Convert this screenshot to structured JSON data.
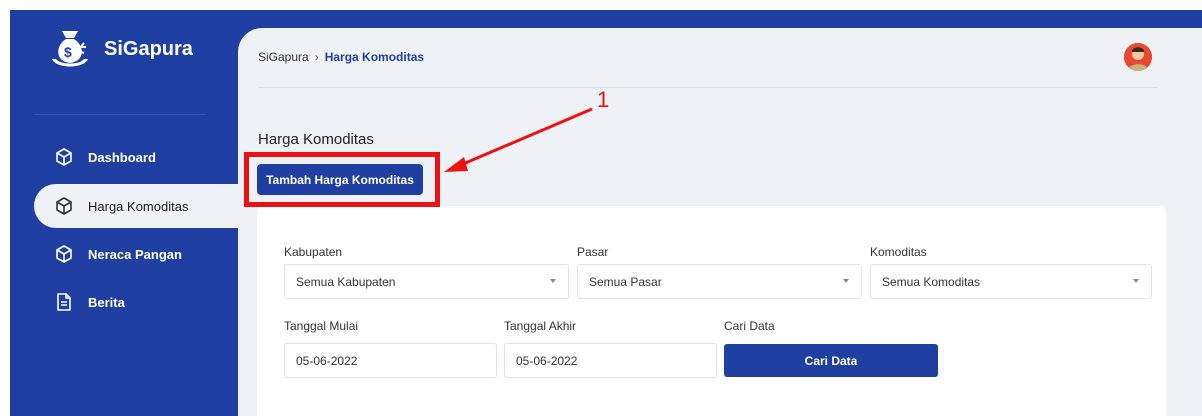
{
  "sidebar": {
    "brand": "SiGapura",
    "items": [
      {
        "label": "Dashboard",
        "icon": "cube-icon"
      },
      {
        "label": "Harga Komoditas",
        "icon": "cube-icon",
        "active": true
      },
      {
        "label": "Neraca Pangan",
        "icon": "cube-icon"
      },
      {
        "label": "Berita",
        "icon": "document-icon"
      }
    ]
  },
  "header": {
    "breadcrumb_root": "SiGapura",
    "breadcrumb_sep": "›",
    "breadcrumb_current": "Harga Komoditas"
  },
  "main": {
    "title": "Harga Komoditas",
    "add_button": "Tambah Harga Komoditas"
  },
  "filters": {
    "kabupaten_label": "Kabupaten",
    "kabupaten_value": "Semua Kabupaten",
    "pasar_label": "Pasar",
    "pasar_value": "Semua Pasar",
    "komoditas_label": "Komoditas",
    "komoditas_value": "Semua Komoditas",
    "tanggal_mulai_label": "Tanggal Mulai",
    "tanggal_mulai_value": "05-06-2022",
    "tanggal_akhir_label": "Tanggal Akhir",
    "tanggal_akhir_value": "05-06-2022",
    "cari_label": "Cari Data",
    "cari_button": "Cari Data"
  },
  "annotation": {
    "number": "1"
  },
  "colors": {
    "primary": "#1f3fa3",
    "panel": "#eef2f7",
    "annotation": "#ee1111"
  }
}
